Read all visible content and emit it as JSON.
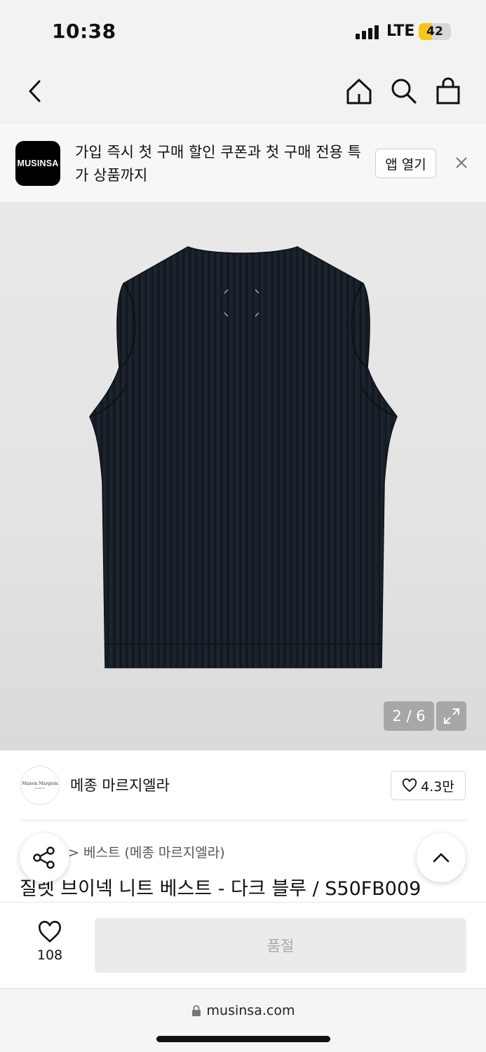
{
  "status_bar": {
    "time": "10:38",
    "network": "LTE",
    "battery": "42",
    "battery_level": 0.42,
    "battery_color": "#f5c518"
  },
  "nav": {
    "back_icon": "chevron-left-icon",
    "home_icon": "home-icon",
    "search_icon": "search-icon",
    "cart_icon": "shopping-bag-icon"
  },
  "promo": {
    "logo_text": "MUSINSA",
    "message": "가입 즉시 첫 구매 할인 쿠폰과 첫 구매 전용 특가 상품까지",
    "open_app_label": "앱 열기",
    "close_icon": "close-icon"
  },
  "gallery": {
    "counter": "2 / 6",
    "current": 2,
    "total": 6,
    "expand_icon": "expand-icon"
  },
  "brand": {
    "logo_text": "Maison Margiela",
    "logo_subtext": "PARIS",
    "name": "메종 마르지엘라",
    "like_count": "4.3만",
    "like_icon": "heart-outline-icon"
  },
  "product": {
    "breadcrumb": "> 베스트 (메종 마르지엘라)",
    "title": "질렛 브이넥 니트 베스트 - 다크 블루 / S50FB009"
  },
  "floating": {
    "share_icon": "share-icon",
    "scroll_top_icon": "chevron-up-icon"
  },
  "bottom_bar": {
    "wish_count": "108",
    "wish_icon": "heart-outline-icon",
    "soldout_label": "품절"
  },
  "browser": {
    "url": "musinsa.com",
    "lock_icon": "lock-icon"
  },
  "colors": {
    "vest": "#1a2029",
    "accent": "#000000"
  }
}
